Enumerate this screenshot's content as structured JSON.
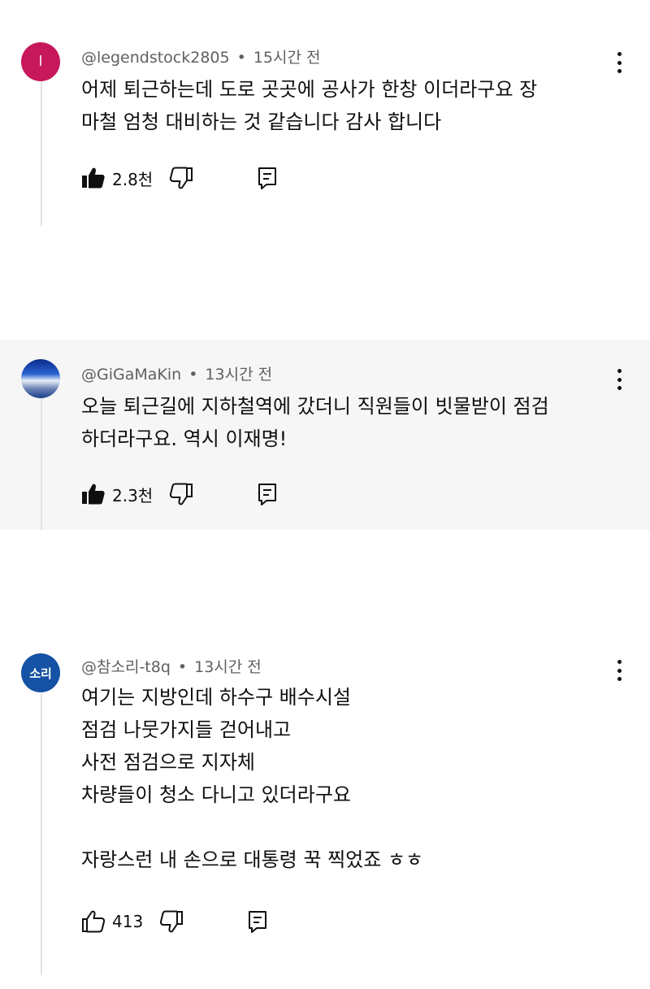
{
  "comments": [
    {
      "avatar_text": "l",
      "handle": "@legendstock2805",
      "separator": "•",
      "time": "15시간 전",
      "text": "어제 퇴근하는데 도로 곳곳에 공사가 한창 이더라구요 장\n마철  엄청 대비하는 것 같습니다 감사 합니다",
      "likes": "2.8천",
      "liked": true
    },
    {
      "avatar_text": "",
      "handle": "@GiGaMaKin",
      "separator": "•",
      "time": "13시간 전",
      "text": "오늘 퇴근길에 지하철역에 갔더니 직원들이 빗물받이 점검\n하더라구요. 역시 이재명!",
      "likes": "2.3천",
      "liked": true
    },
    {
      "avatar_text": "소리",
      "handle": "@참소리-t8q",
      "separator": "•",
      "time": "13시간 전",
      "text": "여기는 지방인데 하수구 배수시설\n점검 나뭇가지들 걷어내고\n사전 점검으로 지자체\n차량들이 청소 다니고 있더라구요\n\n자랑스런 내 손으로 대통령 꾹 찍었죠 ㅎㅎ",
      "likes": "413",
      "liked": false
    }
  ],
  "icons": {
    "like": "thumb-up-icon",
    "dislike": "thumb-down-icon",
    "reply": "reply-icon",
    "menu": "more-vert-icon"
  },
  "colors": {
    "avatar_1": "#c8185c",
    "avatar_3": "#1552a3",
    "meta_text": "#606060",
    "alt_background": "#f6f6f6"
  }
}
